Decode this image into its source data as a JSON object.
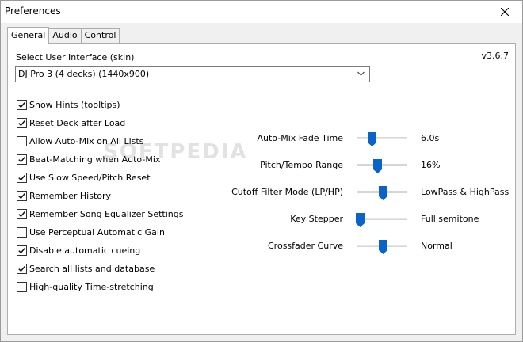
{
  "window": {
    "title": "Preferences"
  },
  "tabs": [
    {
      "label": "General",
      "active": true
    },
    {
      "label": "Audio",
      "active": false
    },
    {
      "label": "Control",
      "active": false
    }
  ],
  "general": {
    "version": "v3.6.7",
    "skin_label": "Select User Interface (skin)",
    "skin_value": "DJ Pro 3 (4 decks) (1440x900)",
    "checkboxes": [
      {
        "label": "Show Hints (tooltips)",
        "checked": true
      },
      {
        "label": "Reset Deck after Load",
        "checked": true
      },
      {
        "label": "Allow Auto-Mix on All Lists",
        "checked": false
      },
      {
        "label": "Beat-Matching when Auto-Mix",
        "checked": true
      },
      {
        "label": "Use Slow Speed/Pitch Reset",
        "checked": true
      },
      {
        "label": "Remember History",
        "checked": true
      },
      {
        "label": "Remember Song Equalizer Settings",
        "checked": true
      },
      {
        "label": "Use Perceptual Automatic Gain",
        "checked": false
      },
      {
        "label": "Disable automatic cueing",
        "checked": true
      },
      {
        "label": "Search all lists and database",
        "checked": true
      },
      {
        "label": "High-quality Time-stretching",
        "checked": false
      }
    ],
    "sliders": [
      {
        "label": "Auto-Mix Fade Time",
        "value": "6.0s",
        "level": 0.28
      },
      {
        "label": "Pitch/Tempo Range",
        "value": "16%",
        "level": 0.39
      },
      {
        "label": "Cutoff Filter Mode (LP/HP)",
        "value": "LowPass & HighPass",
        "level": 0.5
      },
      {
        "label": "Key Stepper",
        "value": "Full semitone",
        "level": 0.05
      },
      {
        "label": "Crossfader Curve",
        "value": "Normal",
        "level": 0.5
      }
    ]
  },
  "colors": {
    "slider_thumb": "#0a64c8",
    "panel_bg": "#ffffff",
    "window_bg": "#f0f0f0"
  },
  "watermark": "SOFTPEDIA"
}
